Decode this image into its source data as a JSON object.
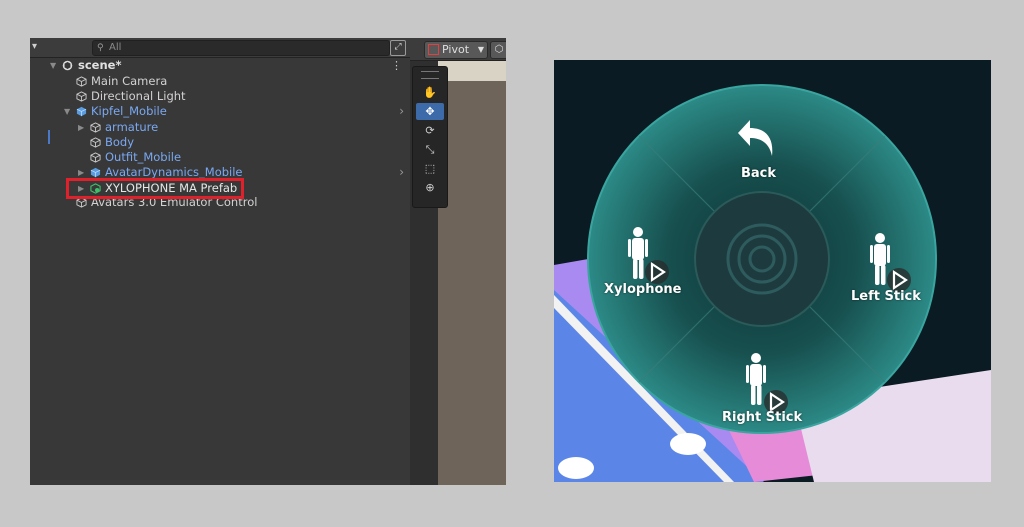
{
  "hierarchy": {
    "search_placeholder": "All",
    "scene_name": "scene*",
    "items": [
      {
        "label": "Main Camera"
      },
      {
        "label": "Directional Light"
      },
      {
        "label": "Kipfel_Mobile"
      },
      {
        "label": "armature"
      },
      {
        "label": "Body"
      },
      {
        "label": "Outfit_Mobile"
      },
      {
        "label": "AvatarDynamics_Mobile"
      },
      {
        "label": "XYLOPHONE MA Prefab"
      },
      {
        "label": "Avatars 3.0 Emulator Control"
      }
    ]
  },
  "scene_toolbar": {
    "pivot_label": "Pivot"
  },
  "colors": {
    "highlight": "#e0202a",
    "prefab_blue": "#7aa8f2",
    "prefab_green": "#3fbf6a",
    "menu_teal": "#2c8a86"
  },
  "radial_menu": {
    "back_label": "Back",
    "items": [
      {
        "label": "Xylophone"
      },
      {
        "label": "Left Stick"
      },
      {
        "label": "Right Stick"
      }
    ]
  }
}
